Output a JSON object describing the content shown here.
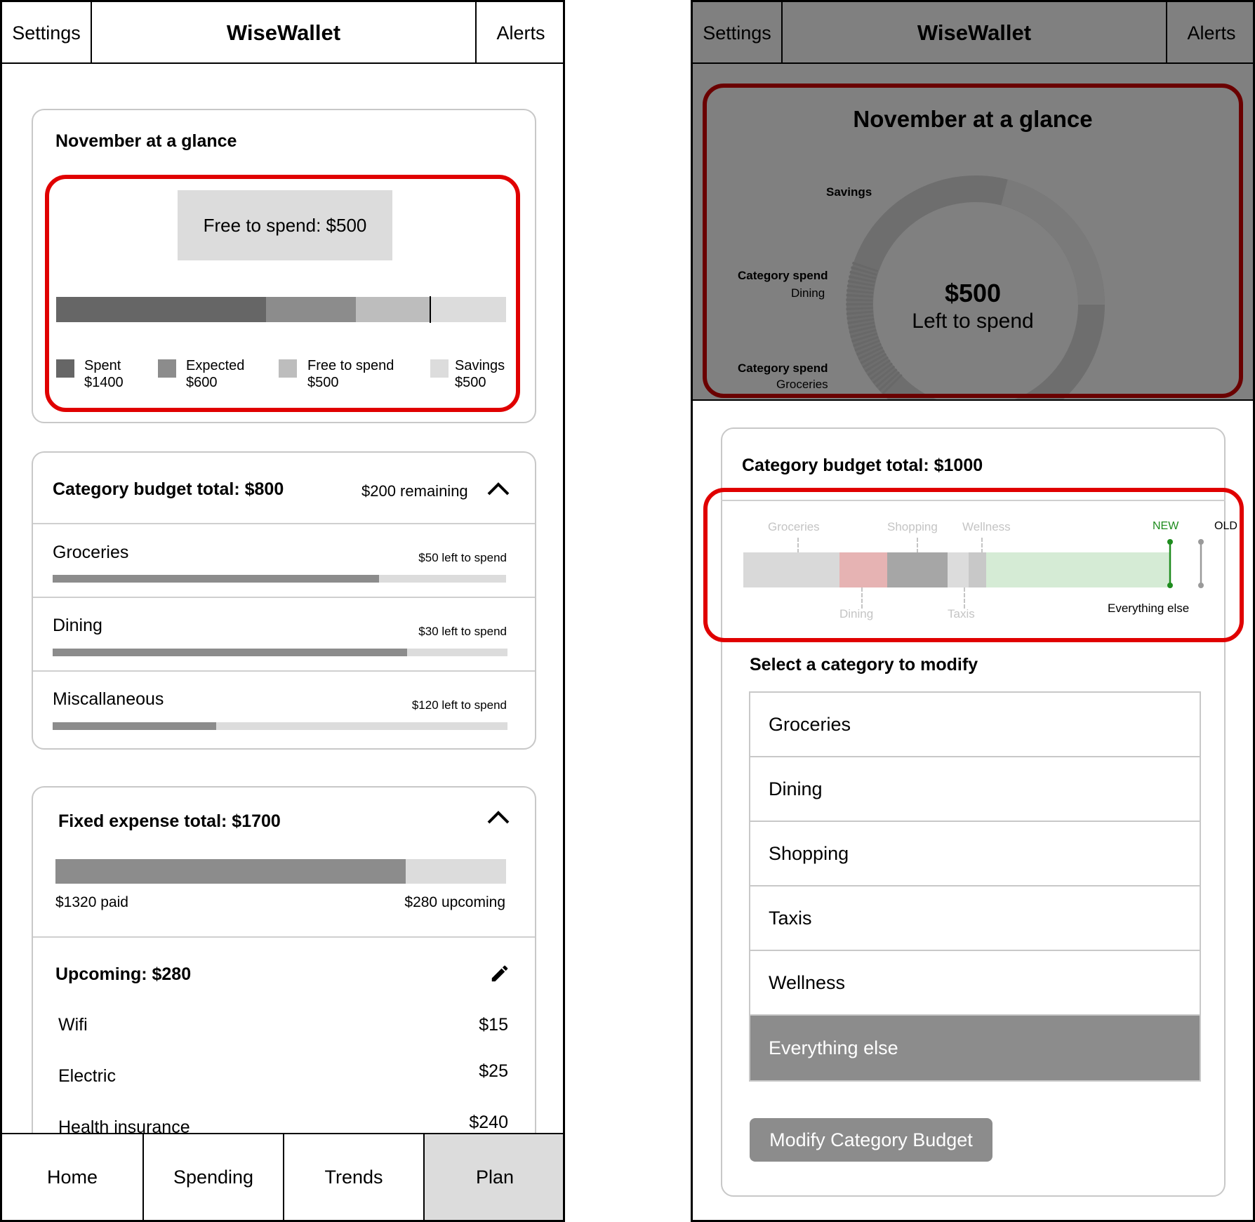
{
  "app": {
    "title": "WiseWallet",
    "settings_label": "Settings",
    "alerts_label": "Alerts"
  },
  "left": {
    "glance": {
      "title": "November at a glance",
      "free_to_spend_banner": "Free to spend: $500",
      "bar_segments": [
        {
          "name": "Spent",
          "value": 1400,
          "color": "#666666"
        },
        {
          "name": "Expected",
          "value": 600,
          "color": "#8c8c8c"
        },
        {
          "name": "Free to spend",
          "value": 500,
          "color": "#bdbdbd"
        },
        {
          "name": "Savings",
          "value": 500,
          "color": "#dcdcdc"
        }
      ],
      "legend": [
        {
          "label": "Spent",
          "amount": "$1400"
        },
        {
          "label": "Expected",
          "amount": "$600"
        },
        {
          "label": "Free to spend",
          "amount": "$500"
        },
        {
          "label": "Savings",
          "amount": "$500"
        }
      ]
    },
    "category_budget": {
      "title": "Category budget total: $800",
      "remaining": "$200 remaining",
      "items": [
        {
          "name": "Groceries",
          "left": "$50 left to spend",
          "progress": 0.72
        },
        {
          "name": "Dining",
          "left": "$30 left to spend",
          "progress": 0.78
        },
        {
          "name": "Miscallaneous",
          "left": "$120 left to spend",
          "progress": 0.36
        }
      ]
    },
    "fixed_expense": {
      "title": "Fixed expense total: $1700",
      "paid_progress": 0.7765,
      "paid_label": "$1320 paid",
      "upcoming_label": "$280 upcoming",
      "upcoming_title": "Upcoming: $280",
      "items": [
        {
          "name": "Wifi",
          "amount": "$15"
        },
        {
          "name": "Electric",
          "amount": "$25"
        },
        {
          "name": "Health insurance",
          "amount": "$240"
        }
      ]
    },
    "nav": [
      "Home",
      "Spending",
      "Trends",
      "Plan"
    ],
    "nav_active": "Plan"
  },
  "right": {
    "glance": {
      "title": "November at a glance",
      "center_amount": "$500",
      "center_label": "Left to spend",
      "labels": {
        "savings": "Savings",
        "category_spend_1": "Category spend",
        "category_spend_1_sub": "Dining",
        "category_spend_2": "Category spend",
        "category_spend_2_sub": "Groceries"
      }
    },
    "sheet": {
      "title": "Category budget total: $1000",
      "bar_labels_top": [
        "Groceries",
        "Shopping",
        "Wellness"
      ],
      "bar_labels_bottom": [
        "Dining",
        "Taxis"
      ],
      "new_label": "NEW",
      "old_label": "OLD",
      "everything_else_label": "Everything else",
      "select_title": "Select a category to modify",
      "categories": [
        "Groceries",
        "Dining",
        "Shopping",
        "Taxis",
        "Wellness",
        "Everything else"
      ],
      "selected": "Everything else",
      "button_label": "Modify Category Budget",
      "colors": {
        "groceries": "#d9d9d9",
        "dining": "#e6b3b3",
        "shopping": "#a6a6a6",
        "taxis": "#dcdcdc",
        "wellness": "#c8c8c8",
        "everything_else": "#d5ebd5",
        "new_marker": "#1e8c1e"
      }
    }
  },
  "highlight_color": "#e00000"
}
